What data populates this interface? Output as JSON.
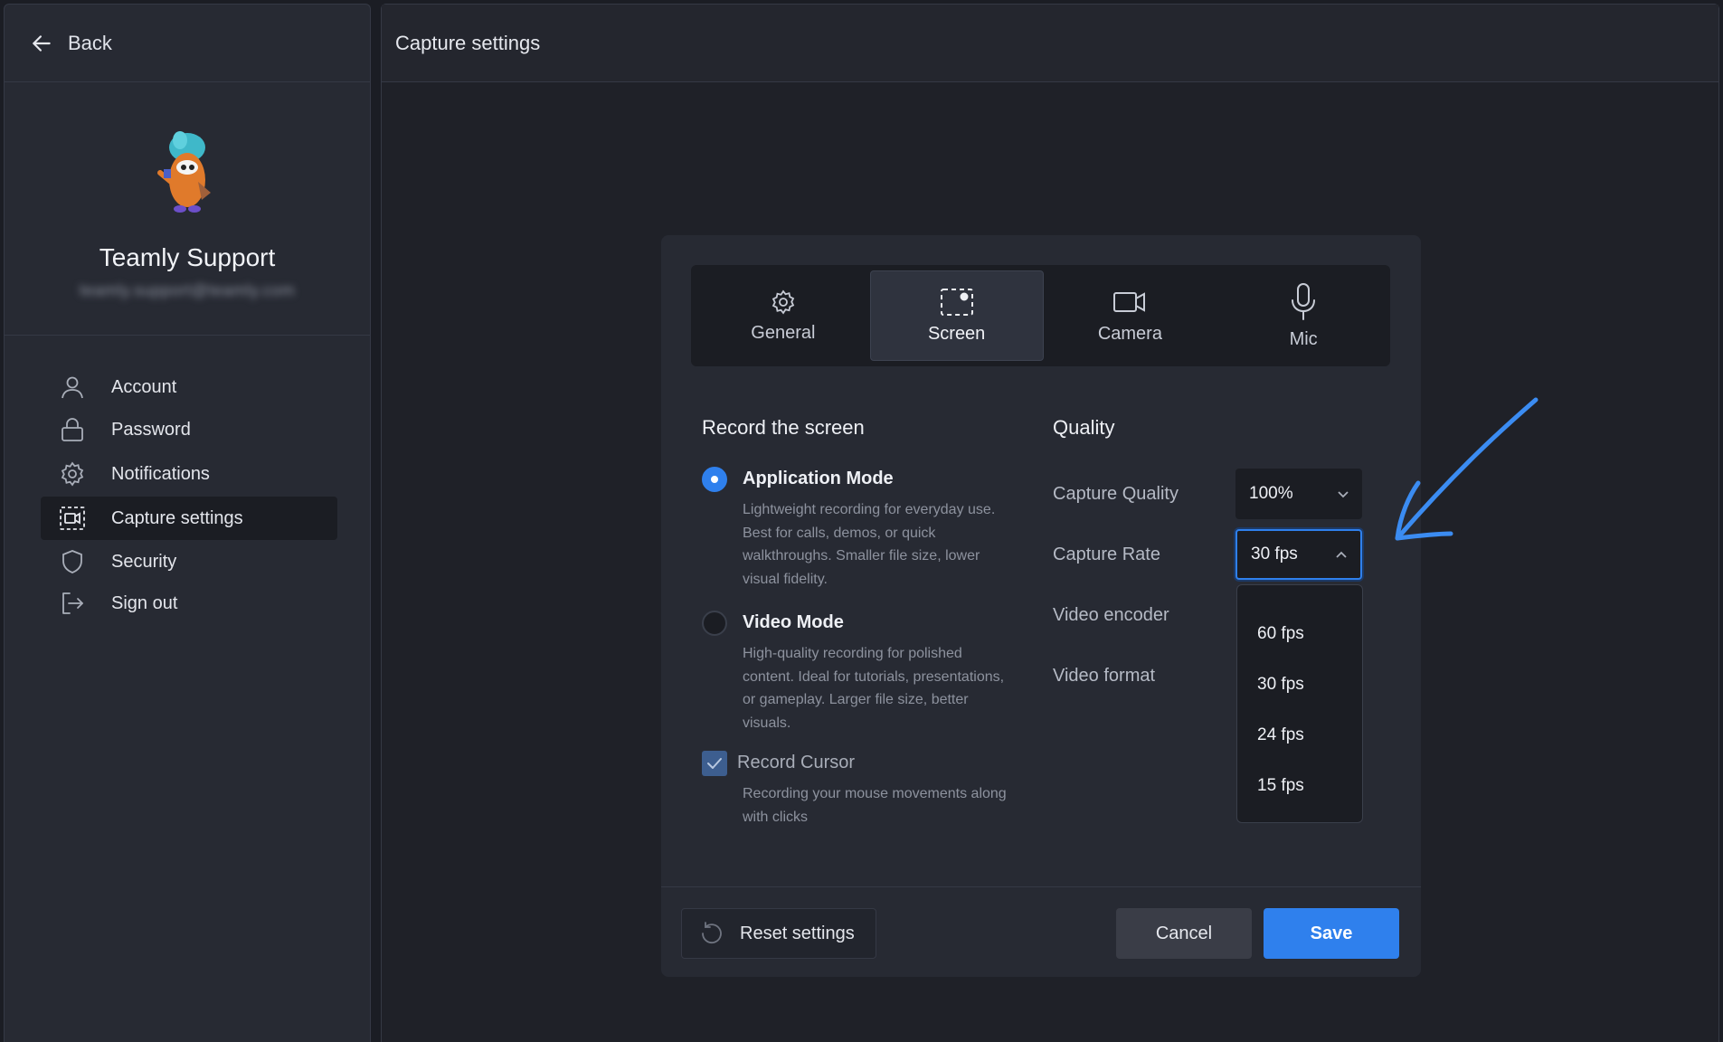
{
  "sidebar": {
    "back_label": "Back",
    "profile_name": "Teamly Support",
    "profile_email": "teamly.support@teamly.com",
    "nav": [
      {
        "label": "Account",
        "icon": "user-icon"
      },
      {
        "label": "Password",
        "icon": "lock-icon"
      },
      {
        "label": "Notifications",
        "icon": "gear-icon"
      },
      {
        "label": "Capture settings",
        "icon": "capture-icon",
        "active": true
      },
      {
        "label": "Security",
        "icon": "shield-icon"
      },
      {
        "label": "Sign out",
        "icon": "sign-out-icon"
      }
    ]
  },
  "main": {
    "title": "Capture settings"
  },
  "dialog": {
    "tabs": [
      {
        "label": "General",
        "icon": "gear-icon"
      },
      {
        "label": "Screen",
        "icon": "screen-select-icon",
        "active": true
      },
      {
        "label": "Camera",
        "icon": "camera-icon"
      },
      {
        "label": "Mic",
        "icon": "microphone-icon"
      }
    ],
    "record": {
      "title": "Record the screen",
      "app_mode": {
        "title": "Application Mode",
        "desc": "Lightweight recording for everyday use. Best for calls, demos, or quick walkthroughs. Smaller file size, lower visual fidelity.",
        "selected": true
      },
      "video_mode": {
        "title": "Video Mode",
        "desc": "High-quality recording for polished content. Ideal for tutorials, presentations, or gameplay. Larger file size, better visuals.",
        "selected": false
      },
      "cursor": {
        "title": "Record Cursor",
        "desc": "Recording your mouse movements along with clicks",
        "checked": true
      }
    },
    "quality": {
      "title": "Quality",
      "capture_quality_label": "Capture Quality",
      "capture_quality_value": "100%",
      "capture_rate_label": "Capture Rate",
      "capture_rate_value": "30 fps",
      "encoder_label": "Video encoder",
      "format_label": "Video format",
      "rate_options": [
        "60 fps",
        "30 fps",
        "24 fps",
        "15 fps"
      ]
    },
    "footer": {
      "reset_label": "Reset settings",
      "cancel_label": "Cancel",
      "save_label": "Save"
    }
  },
  "colors": {
    "accent": "#2f80ed",
    "panel": "#272a33",
    "background": "#1b1d24",
    "annotation_arrow": "#3b8cf2"
  }
}
